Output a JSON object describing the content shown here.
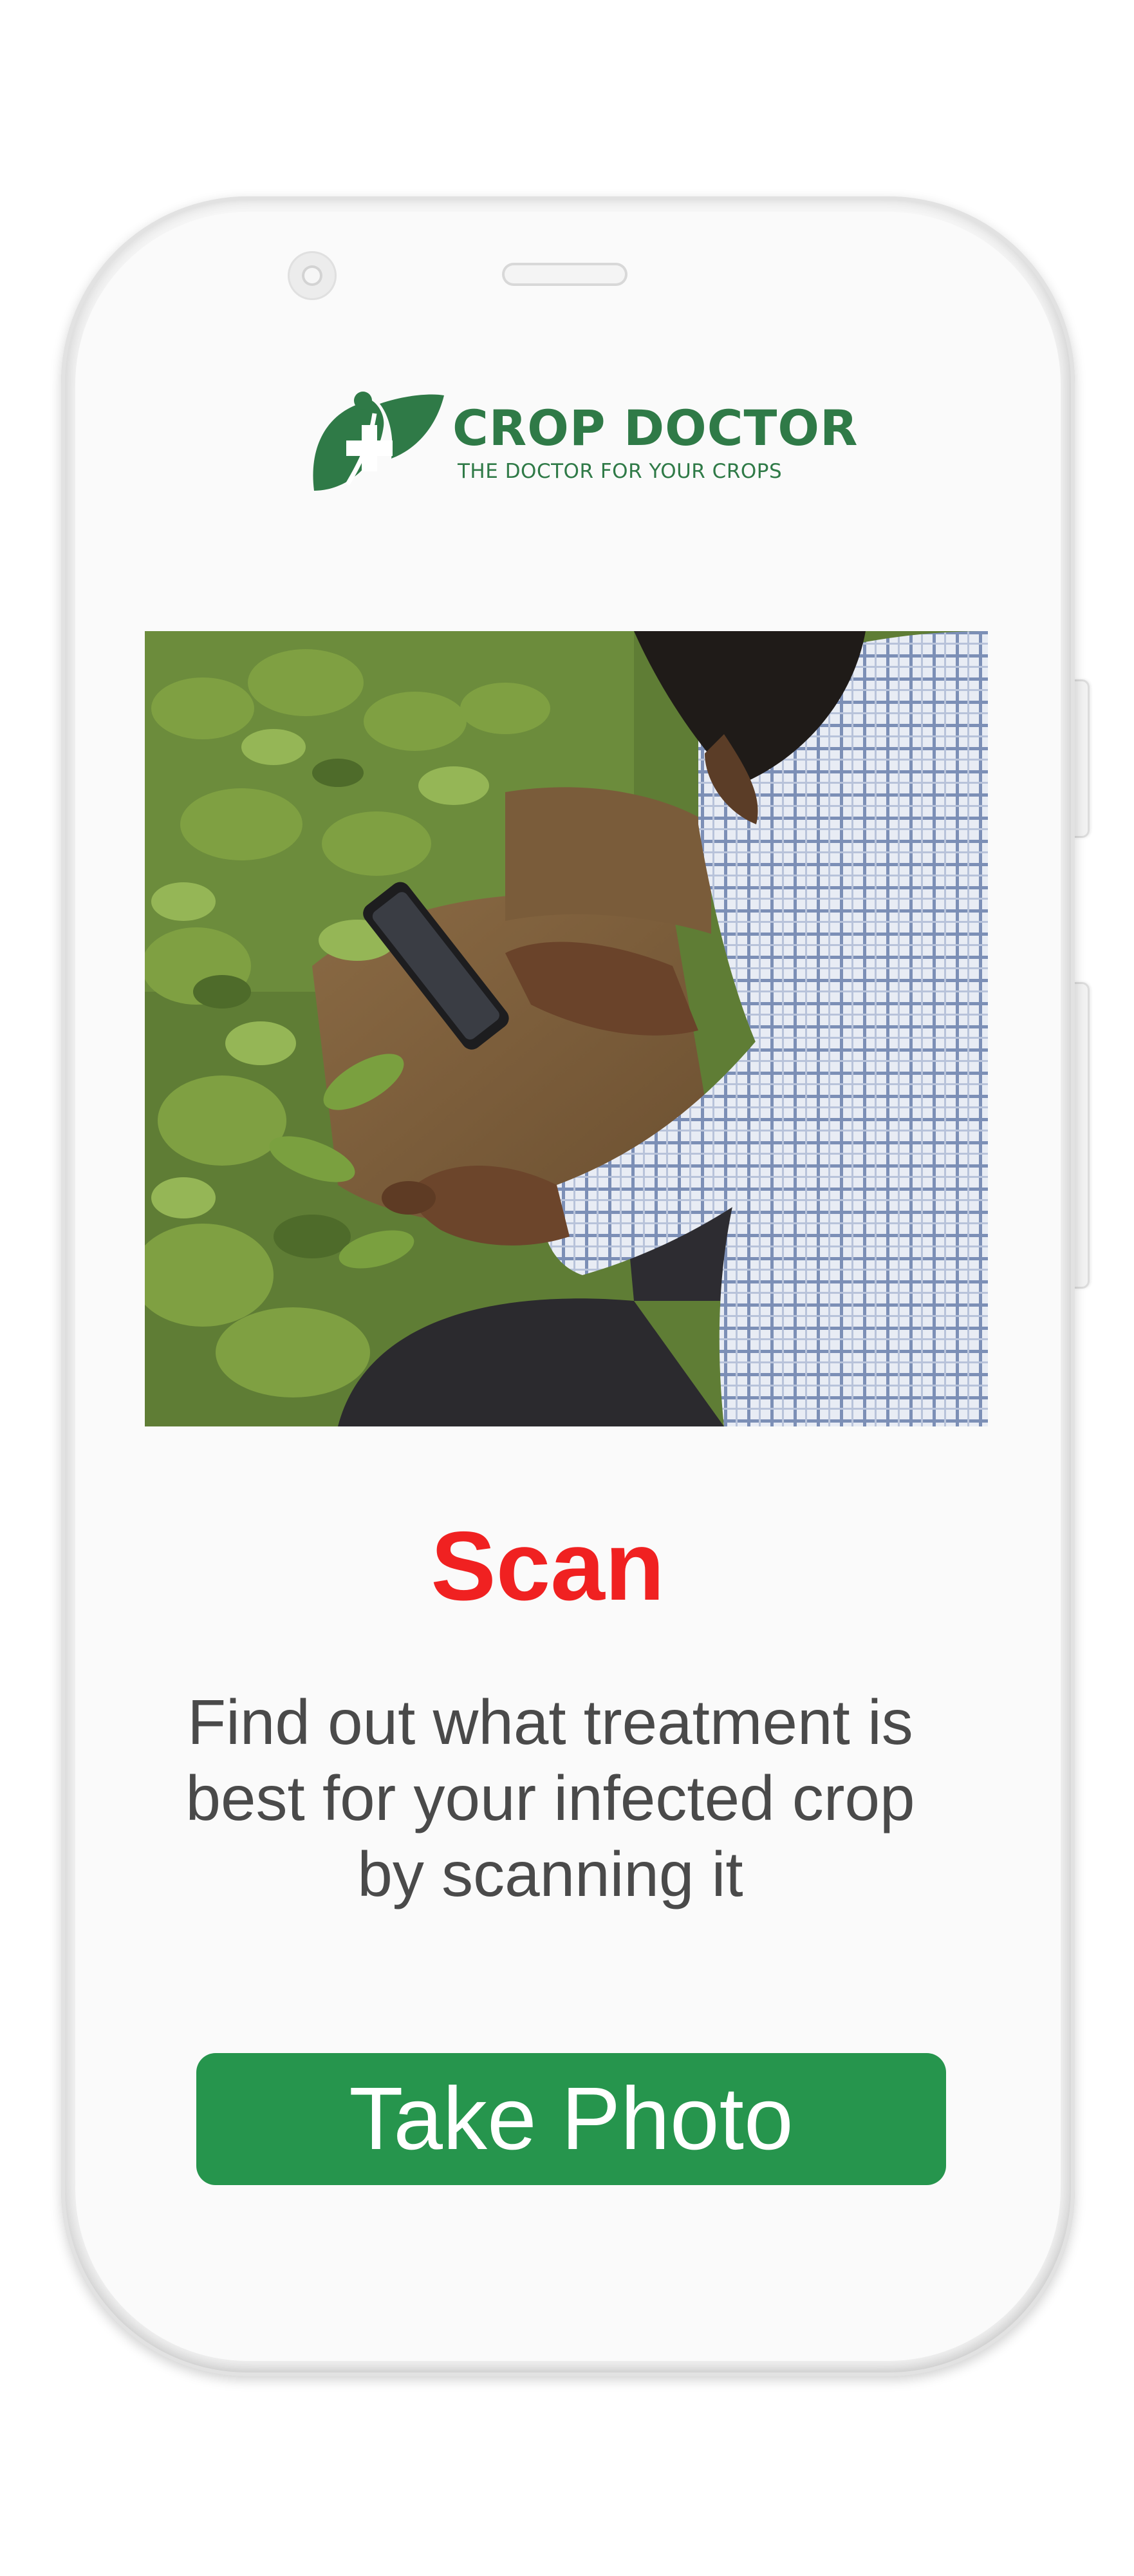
{
  "brand": {
    "name": "CROP DOCTOR",
    "tagline": "THE DOCTOR FOR YOUR CROPS",
    "color": "#2f7a47"
  },
  "hero": {
    "image_description": "farmer-scanning-crop-photo"
  },
  "content": {
    "headline": "Scan",
    "headline_color": "#f02121",
    "description": "Find out what treatment is best for your infected crop by scanning it"
  },
  "actions": {
    "take_photo_label": "Take Photo",
    "button_color": "#26954d"
  }
}
